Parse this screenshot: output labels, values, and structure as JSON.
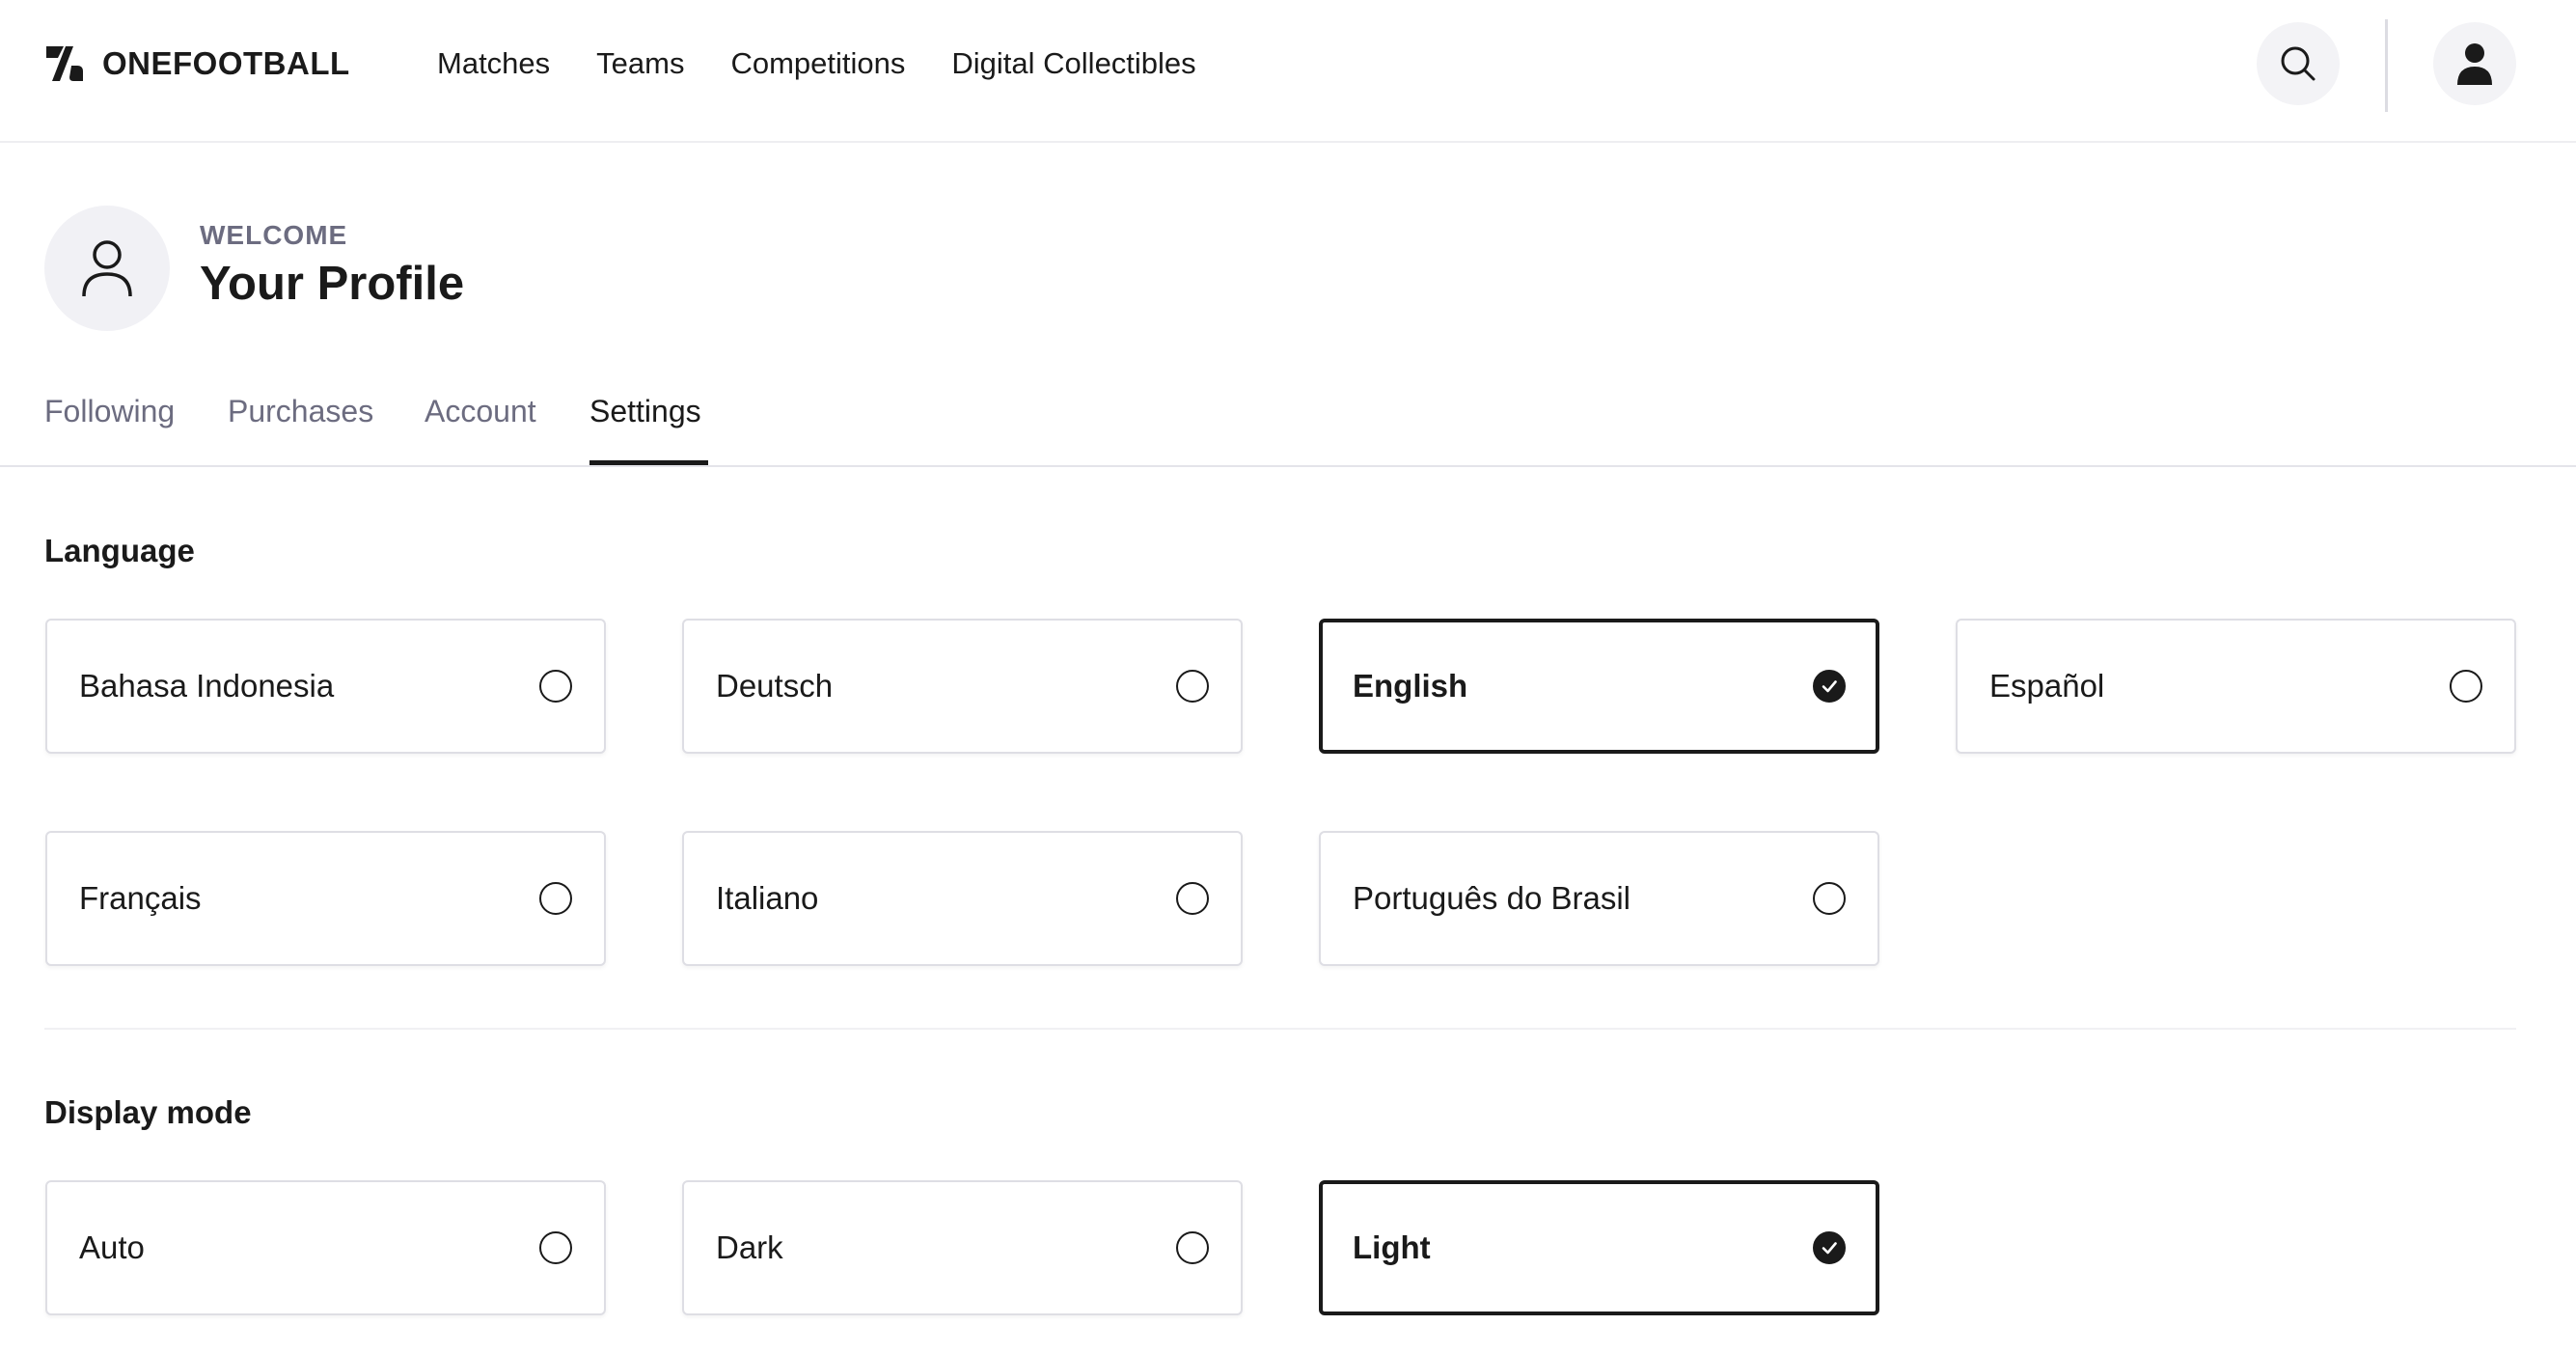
{
  "app": {
    "brand": "ONEFOOTBALL"
  },
  "header": {
    "nav": [
      {
        "label": "Matches"
      },
      {
        "label": "Teams"
      },
      {
        "label": "Competitions"
      },
      {
        "label": "Digital Collectibles"
      }
    ],
    "icons": {
      "search": "search-icon",
      "user": "user-icon"
    }
  },
  "profile": {
    "welcome": "WELCOME",
    "title": "Your Profile"
  },
  "tabs": [
    {
      "label": "Following",
      "active": false
    },
    {
      "label": "Purchases",
      "active": false
    },
    {
      "label": "Account",
      "active": false
    },
    {
      "label": "Settings",
      "active": true
    }
  ],
  "language": {
    "title": "Language",
    "options": [
      {
        "label": "Bahasa Indonesia",
        "selected": false
      },
      {
        "label": "Deutsch",
        "selected": false
      },
      {
        "label": "English",
        "selected": true
      },
      {
        "label": "Español",
        "selected": false
      },
      {
        "label": "Français",
        "selected": false
      },
      {
        "label": "Italiano",
        "selected": false
      },
      {
        "label": "Português do Brasil",
        "selected": false
      }
    ]
  },
  "display_mode": {
    "title": "Display mode",
    "options": [
      {
        "label": "Auto",
        "selected": false
      },
      {
        "label": "Dark",
        "selected": false
      },
      {
        "label": "Light",
        "selected": true
      }
    ]
  },
  "colors": {
    "text": "#1a1a1a",
    "muted": "#6c6c80",
    "border": "#dedee4",
    "icon_bg": "#f3f3f6"
  }
}
